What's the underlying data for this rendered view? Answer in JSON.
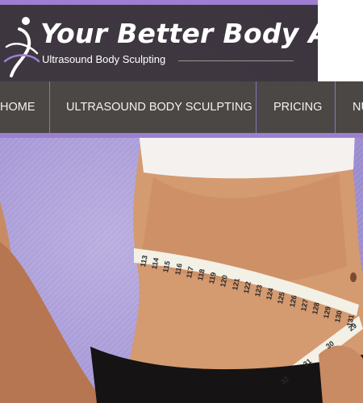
{
  "site": {
    "title": "Your Better Body AZ",
    "tagline": "Ultrasound Body Sculpting"
  },
  "nav": {
    "items": [
      {
        "label": "HOME"
      },
      {
        "label": "ULTRASOUND BODY SCULPTING"
      },
      {
        "label": "PRICING"
      },
      {
        "label": "NU"
      }
    ]
  },
  "colors": {
    "accent": "#9c7fd1",
    "header_bg": "#2d2828",
    "nav_bg": "#4b4745",
    "hero_bg": "#a597d6"
  },
  "icons": [
    "figure-logo-icon"
  ],
  "hero": {
    "measuring_tape_numbers": [
      "113",
      "114",
      "115",
      "116",
      "117",
      "118",
      "119",
      "120",
      "121",
      "122",
      "123",
      "124",
      "125",
      "126",
      "127",
      "128",
      "129",
      "130",
      "131"
    ],
    "lower_tape_numbers": [
      "29",
      "30",
      "31",
      "32"
    ]
  }
}
